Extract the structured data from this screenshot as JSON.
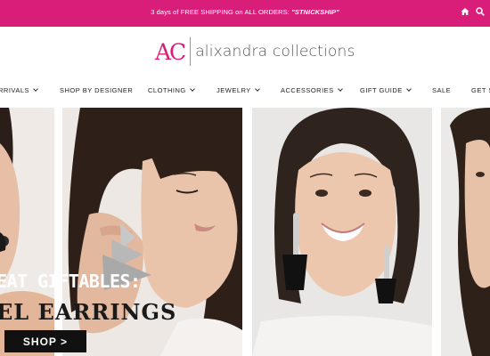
{
  "promo": {
    "text": "3 days of FREE SHIPPING on ALL ORDERS: ",
    "code": "\"STNICKSHIP\"",
    "icons": [
      "home-icon",
      "search-icon"
    ]
  },
  "brand": {
    "monogram": "AC",
    "name": "alixandra collections",
    "accent_color": "#d91e7a"
  },
  "nav": {
    "items": [
      {
        "label": "RRIVALS",
        "has_dropdown": true
      },
      {
        "label": "SHOP BY DESIGNER",
        "has_dropdown": false
      },
      {
        "label": "CLOTHING",
        "has_dropdown": true
      },
      {
        "label": "JEWELRY",
        "has_dropdown": true
      },
      {
        "label": "ACCESSORIES",
        "has_dropdown": true
      },
      {
        "label": "GIFT GUIDE",
        "has_dropdown": true
      },
      {
        "label": "SALE",
        "has_dropdown": false
      },
      {
        "label": "GET S",
        "has_dropdown": false
      }
    ]
  },
  "hero": {
    "headline_1": "EAT GIFTABLES:",
    "headline_2": "EL EARRINGS",
    "cta_label": "SHOP >"
  }
}
